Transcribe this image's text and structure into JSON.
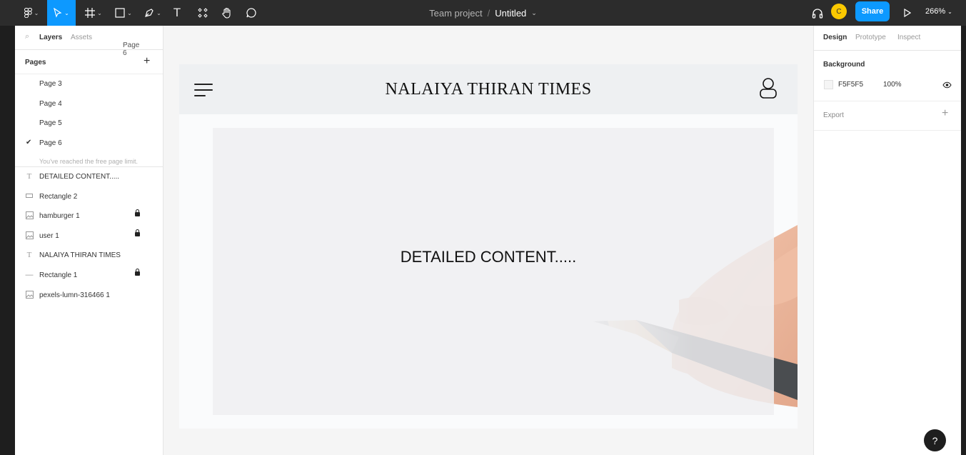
{
  "toolbar": {
    "zoom": "266%",
    "share_label": "Share",
    "avatar_initial": "C",
    "project": "Team project",
    "separator": "/",
    "file_name": "Untitled"
  },
  "left_panel": {
    "tabs": {
      "layers": "Layers",
      "assets": "Assets",
      "page": "Page 6"
    },
    "pages_header": "Pages",
    "pages": [
      {
        "label": "Page 3",
        "active": false
      },
      {
        "label": "Page 4",
        "active": false
      },
      {
        "label": "Page 5",
        "active": false
      },
      {
        "label": "Page 6",
        "active": true
      }
    ],
    "limit_text": "You've reached the free page limit.",
    "layers": [
      {
        "label": "DETAILED CONTENT.....",
        "icon": "text-icon",
        "locked": false
      },
      {
        "label": "Rectangle 2",
        "icon": "rectangle-icon",
        "locked": false
      },
      {
        "label": "hamburger 1",
        "icon": "image-icon",
        "locked": true
      },
      {
        "label": "user 1",
        "icon": "image-icon",
        "locked": true
      },
      {
        "label": "NALAIYA THIRAN TIMES",
        "icon": "text-icon",
        "locked": false
      },
      {
        "label": "Rectangle 1",
        "icon": "line-icon",
        "locked": true
      },
      {
        "label": "pexels-lumn-316466 1",
        "icon": "image-icon",
        "locked": false
      }
    ]
  },
  "canvas": {
    "site_title": "NALAIYA THIRAN TIMES",
    "content_text": "DETAILED CONTENT....."
  },
  "right_panel": {
    "tabs": {
      "design": "Design",
      "prototype": "Prototype",
      "inspect": "Inspect"
    },
    "background_label": "Background",
    "background_hex": "F5F5F5",
    "background_opacity": "100%",
    "export_label": "Export"
  },
  "help_label": "?",
  "colors": {
    "accent": "#0d99ff",
    "toolbar": "#2c2c2c",
    "avatar": "#fbc900",
    "canvas_bg": "#f5f5f5"
  }
}
